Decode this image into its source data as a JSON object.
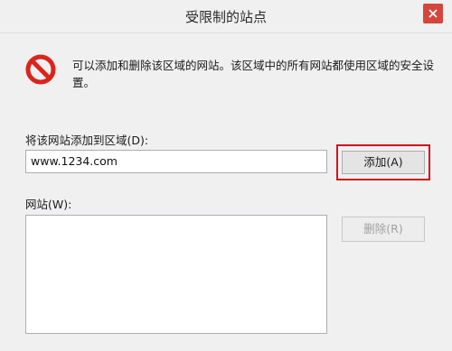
{
  "window": {
    "title": "受限制的站点"
  },
  "info": {
    "message": "可以添加和删除该区域的网站。该区域中的所有网站都使用区域的安全设置。"
  },
  "add_section": {
    "label": "将该网站添加到区域(D):",
    "input_value": "www.1234.com",
    "add_button": "添加(A)"
  },
  "sites_section": {
    "label": "网站(W):",
    "items": [],
    "remove_button": "删除(R)"
  },
  "colors": {
    "close_button": "#d6453d",
    "highlight_border": "#d0141c",
    "no_icon": "#d9251c"
  },
  "icons": {
    "close": "close-icon",
    "restricted": "restricted-no-entry-icon"
  }
}
